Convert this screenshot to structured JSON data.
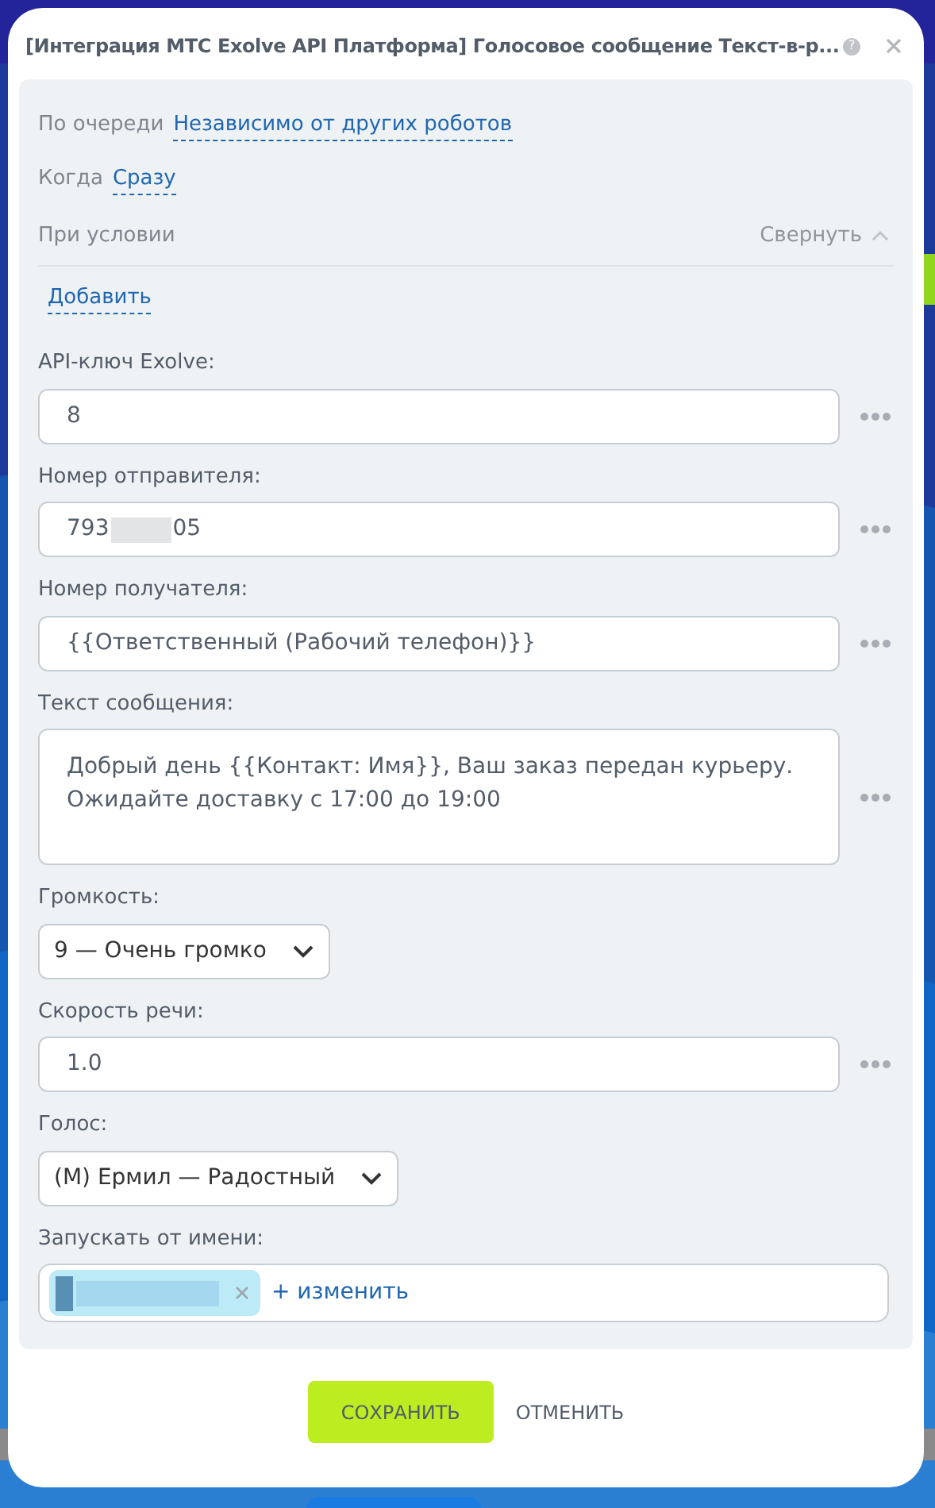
{
  "dialog": {
    "title": "[Интеграция МТС Exolve API Платформа] Голосовое сообщение Текст-в-р...",
    "help": "?"
  },
  "settings": [
    {
      "label": "По очереди",
      "value": "Независимо от других роботов"
    },
    {
      "label": "Когда",
      "value": "Сразу"
    }
  ],
  "condition": {
    "label": "При условии",
    "collapse": "Свернуть",
    "expanded": true,
    "add": "Добавить"
  },
  "fields": [
    {
      "kind": "input",
      "label": "API-ключ Exolve:",
      "value": "8"
    },
    {
      "kind": "masked",
      "label": "Номер отправителя:",
      "value_start": "793",
      "value_end": "05"
    },
    {
      "kind": "input",
      "label": "Номер получателя:",
      "value": "{{Ответственный (Рабочий телефон)}}"
    },
    {
      "kind": "textarea",
      "label": "Текст сообщения:",
      "value": "Добрый день {{Контакт: Имя}}, Ваш заказ передан курьеру. Ожидайте доставку с 17:00 до 19:00"
    },
    {
      "kind": "select",
      "label": "Громкость:",
      "value": "9 — Очень громко"
    },
    {
      "kind": "input",
      "label": "Скорость речи:",
      "value": "1.0"
    },
    {
      "kind": "select",
      "label": "Голос:",
      "value": "(М) Ермил — Радостный"
    },
    {
      "kind": "user",
      "label": "Запускать от имени:",
      "change": "+ изменить"
    }
  ],
  "buttons": [
    {
      "kind": "primary",
      "label": "СОХРАНИТЬ"
    },
    {
      "kind": "plain",
      "label": "ОТМЕНИТЬ"
    }
  ]
}
